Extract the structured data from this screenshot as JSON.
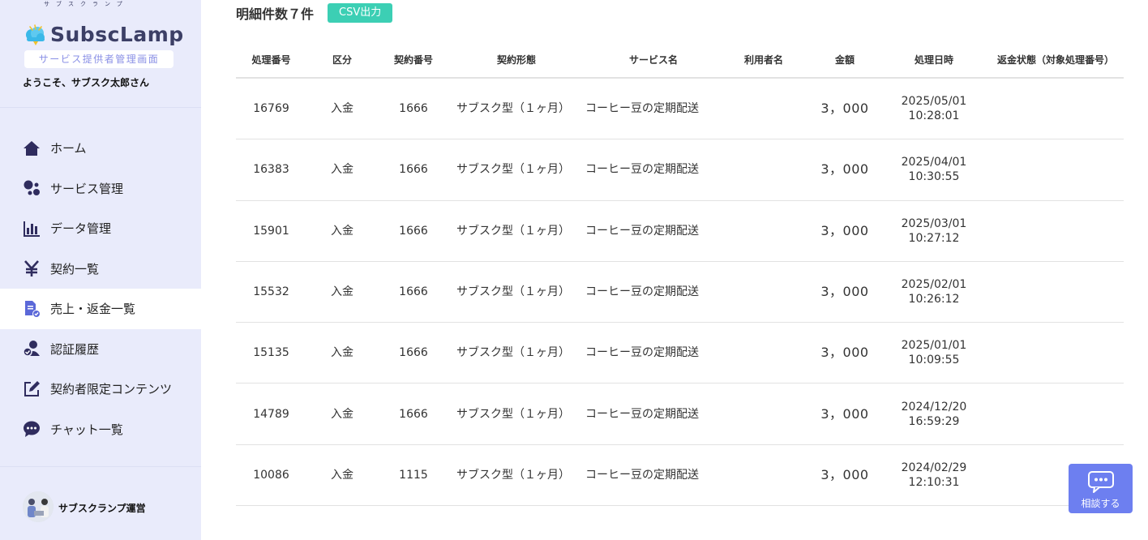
{
  "brand": {
    "name": "SubscLamp",
    "ruby": "サブスクランプ",
    "badge": "サービス提供者管理画面",
    "welcome": "ようこそ、サブスク太郎さん"
  },
  "nav": {
    "items": [
      {
        "label": "ホーム",
        "icon": "home-icon"
      },
      {
        "label": "サービス管理",
        "icon": "services-icon"
      },
      {
        "label": "データ管理",
        "icon": "bar-chart-icon"
      },
      {
        "label": "契約一覧",
        "icon": "yen-icon"
      },
      {
        "label": "売上・返金一覧",
        "icon": "document-check-icon",
        "active": true
      },
      {
        "label": "認証履歴",
        "icon": "user-check-icon"
      },
      {
        "label": "契約者限定コンテンツ",
        "icon": "edit-icon"
      },
      {
        "label": "チャット一覧",
        "icon": "chat-bubble-icon"
      }
    ]
  },
  "operator": {
    "name": "サブスクランプ運営"
  },
  "main": {
    "count_text": "明細件数７件",
    "csv_label": "CSV出力"
  },
  "table": {
    "headers": [
      "処理番号",
      "区分",
      "契約番号",
      "契約形態",
      "サービス名",
      "利用者名",
      "金額",
      "処理日時",
      "返金状態（対象処理番号）"
    ],
    "rows": [
      {
        "id": "16769",
        "type": "入金",
        "contract": "1666",
        "form": "サブスク型（１ヶ月）",
        "service": "コーヒー豆の定期配送",
        "user": "",
        "amount": "3，000",
        "date": "2025/05/01",
        "time": "10:28:01",
        "refund": ""
      },
      {
        "id": "16383",
        "type": "入金",
        "contract": "1666",
        "form": "サブスク型（１ヶ月）",
        "service": "コーヒー豆の定期配送",
        "user": "",
        "amount": "3，000",
        "date": "2025/04/01",
        "time": "10:30:55",
        "refund": ""
      },
      {
        "id": "15901",
        "type": "入金",
        "contract": "1666",
        "form": "サブスク型（１ヶ月）",
        "service": "コーヒー豆の定期配送",
        "user": "",
        "amount": "3，000",
        "date": "2025/03/01",
        "time": "10:27:12",
        "refund": ""
      },
      {
        "id": "15532",
        "type": "入金",
        "contract": "1666",
        "form": "サブスク型（１ヶ月）",
        "service": "コーヒー豆の定期配送",
        "user": "",
        "amount": "3，000",
        "date": "2025/02/01",
        "time": "10:26:12",
        "refund": ""
      },
      {
        "id": "15135",
        "type": "入金",
        "contract": "1666",
        "form": "サブスク型（１ヶ月）",
        "service": "コーヒー豆の定期配送",
        "user": "",
        "amount": "3，000",
        "date": "2025/01/01",
        "time": "10:09:55",
        "refund": ""
      },
      {
        "id": "14789",
        "type": "入金",
        "contract": "1666",
        "form": "サブスク型（１ヶ月）",
        "service": "コーヒー豆の定期配送",
        "user": "",
        "amount": "3，000",
        "date": "2024/12/20",
        "time": "16:59:29",
        "refund": ""
      },
      {
        "id": "10086",
        "type": "入金",
        "contract": "1115",
        "form": "サブスク型（１ヶ月）",
        "service": "コーヒー豆の定期配送",
        "user": "",
        "amount": "3，000",
        "date": "2024/02/29",
        "time": "12:10:31",
        "refund": ""
      }
    ]
  },
  "consult": {
    "label": "相談する"
  },
  "colors": {
    "sidebar_bg": "#e9ebfb",
    "accent": "#3ccfb4",
    "brand": "#3c3f66",
    "consult": "#6d7ff0"
  }
}
